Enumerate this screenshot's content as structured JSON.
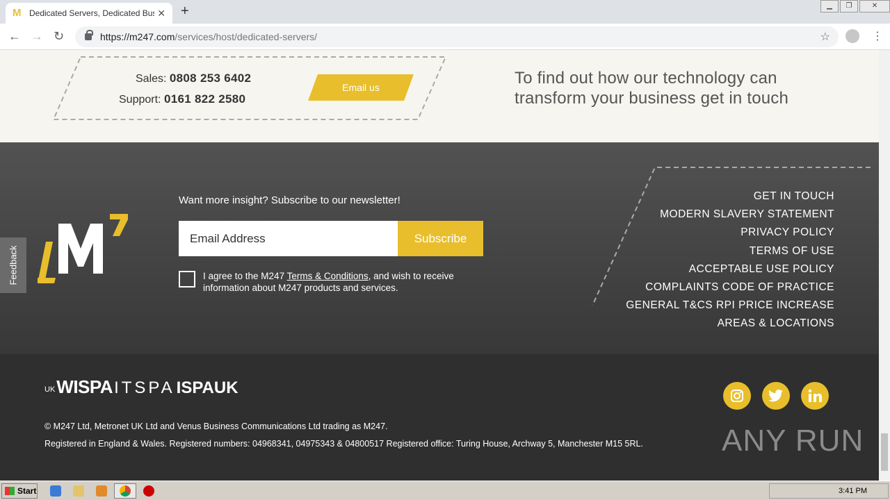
{
  "browser": {
    "tab_title": "Dedicated Servers, Dedicated Business",
    "favicon_letter": "M",
    "new_tab": "+",
    "url_host": "https://m247.com",
    "url_path": "/services/host/dedicated-servers/"
  },
  "contact": {
    "sales_label": "Sales:",
    "sales_number": "0808 253 6402",
    "support_label": "Support:",
    "support_number": "0161 822 2580",
    "email_button": "Email us",
    "cta_line1": "To find out how our technology can",
    "cta_line2": "transform your business get in touch"
  },
  "footer": {
    "feedback": "Feedback",
    "newsletter_heading": "Want more insight? Subscribe to our newsletter!",
    "email_placeholder": "Email Address",
    "subscribe_label": "Subscribe",
    "agree_prefix": "I agree to the M247 ",
    "agree_link": "Terms & Conditions",
    "agree_suffix": ", and wish to receive information about M247 products and services.",
    "links": [
      "GET IN TOUCH",
      "MODERN SLAVERY STATEMENT",
      "PRIVACY POLICY",
      "TERMS OF USE",
      "ACCEPTABLE USE POLICY",
      "COMPLAINTS CODE OF PRACTICE",
      "GENERAL T&CS RPI PRICE INCREASE",
      "AREAS & LOCATIONS"
    ]
  },
  "bottom": {
    "partner_uk": "UK",
    "partner_wispa": "WISPA",
    "partner_itspa": "ITSPA",
    "partner_ispa": "ISPAUK",
    "copyright": "© M247 Ltd, Metronet UK Ltd and Venus Business Communications Ltd trading as M247.",
    "registered": "Registered in England & Wales. Registered numbers: 04968341, 04975343 & 04800517 Registered office: Turing House, Archway 5, Manchester M15 5RL.",
    "social_icons": [
      "instagram-icon",
      "twitter-icon",
      "linkedin-icon"
    ]
  },
  "watermark": "ANY RUN",
  "taskbar": {
    "start_label": "Start",
    "clock": "3:41 PM"
  },
  "colors": {
    "accent": "#e8be2c",
    "footer_dark": "#2f2f2f",
    "contact_bg": "#f7f5ef"
  }
}
